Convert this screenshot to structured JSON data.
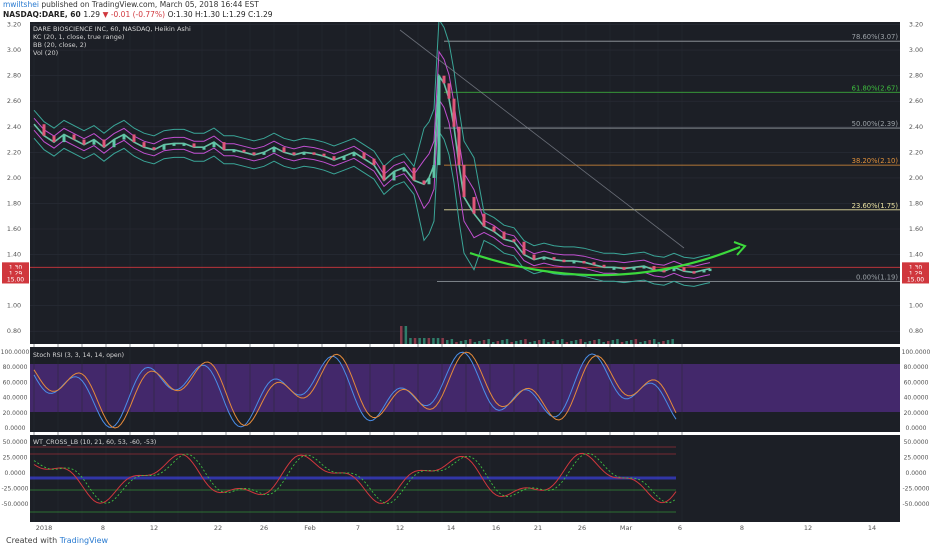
{
  "header": {
    "author": "mwiltshei",
    "published_text": "published on TradingView.com, March 05, 2018 16:44 EST",
    "symbol": "NASDAQ:DARE, 60",
    "last": "1.29",
    "change": "▼ -0.01 (-0.77%)",
    "ohlc": "O:1.30 H:1.30 L:1.29 C:1.29"
  },
  "footer": {
    "created_with": "Created with",
    "brand": "TradingView"
  },
  "legend": {
    "title": "DARE BIOSCIENCE INC, 60, NASDAQ, Heikin Ashi",
    "lines": [
      "KC (20, 1, close, true range)",
      "BB (20, close, 2)",
      "Vol (20)"
    ]
  },
  "price_axis": {
    "ticks": [
      "3.20",
      "3.00",
      "2.80",
      "2.60",
      "2.40",
      "2.20",
      "2.00",
      "1.80",
      "1.60",
      "1.40",
      "1.20",
      "1.00",
      "0.80"
    ],
    "tags": [
      {
        "text": "1.30",
        "color": "#d0373d"
      },
      {
        "text": "1.29",
        "color": "#d0373d"
      },
      {
        "text": "15.00",
        "color": "#d0373d"
      }
    ]
  },
  "x_axis": {
    "labels": [
      "2018",
      "8",
      "12",
      "22",
      "26",
      "Feb",
      "7",
      "12",
      "14",
      "16",
      "21",
      "26",
      "Mar",
      "6",
      "8",
      "12",
      "14"
    ]
  },
  "fib_levels": [
    {
      "label": "78.60%(3.07)",
      "price": 3.07,
      "color": "#9aa0a6"
    },
    {
      "label": "61.80%(2.67)",
      "price": 2.67,
      "color": "#3fbf3f"
    },
    {
      "label": "50.00%(2.39)",
      "price": 2.39,
      "color": "#9aa0a6"
    },
    {
      "label": "38.20%(2.10)",
      "price": 2.1,
      "color": "#e0903a"
    },
    {
      "label": "23.60%(1.75)",
      "price": 1.75,
      "color": "#e8e0a0"
    },
    {
      "label": "0.00%(1.19)",
      "price": 1.19,
      "color": "#9aa0a6"
    }
  ],
  "stoch": {
    "title": "Stoch RSI (3, 3, 14, 14, open)",
    "ticks": [
      "100.0000",
      "80.0000",
      "60.0000",
      "40.0000",
      "20.0000",
      "0.0000"
    ]
  },
  "wt": {
    "title": "WT_CROSS_LB (10, 21, 60, 53, -60, -53)",
    "ticks": [
      "50.0000",
      "25.0000",
      "0.0000",
      "-25.0000",
      "-50.0000"
    ]
  },
  "chart_data": {
    "type": "line",
    "title": "DARE BIOSCIENCE INC, 60, NASDAQ, Heikin Ashi",
    "symbol": "NASDAQ:DARE",
    "interval": "60",
    "ohlc": {
      "open": 1.3,
      "high": 1.3,
      "low": 1.29,
      "close": 1.29
    },
    "ylim": [
      0.7,
      3.22
    ],
    "series": [
      {
        "name": "price",
        "x": [
          0,
          10,
          20,
          30,
          40,
          50,
          60,
          70,
          80,
          90,
          100,
          110,
          120,
          130,
          140,
          150,
          160,
          170,
          180,
          190,
          200,
          210,
          220,
          230,
          240,
          250,
          260,
          270,
          280,
          290,
          300,
          310,
          320,
          330,
          340,
          350,
          360,
          370,
          380,
          390,
          395,
          400,
          405,
          410,
          415,
          420,
          425,
          430,
          440,
          450,
          460,
          470,
          480,
          490,
          500,
          510,
          520,
          530,
          540,
          550,
          560,
          570,
          580,
          590,
          600,
          610,
          620,
          630,
          640,
          650,
          660,
          670,
          676
        ],
        "values": [
          2.42,
          2.33,
          2.28,
          2.34,
          2.3,
          2.26,
          2.3,
          2.24,
          2.3,
          2.34,
          2.28,
          2.24,
          2.22,
          2.26,
          2.27,
          2.27,
          2.24,
          2.24,
          2.28,
          2.22,
          2.22,
          2.2,
          2.18,
          2.2,
          2.24,
          2.2,
          2.18,
          2.2,
          2.19,
          2.17,
          2.14,
          2.17,
          2.2,
          2.15,
          2.1,
          1.98,
          2.05,
          2.08,
          1.98,
          1.95,
          2.0,
          2.1,
          2.8,
          2.74,
          2.62,
          2.4,
          2.1,
          1.85,
          1.72,
          1.62,
          1.58,
          1.52,
          1.5,
          1.4,
          1.36,
          1.38,
          1.36,
          1.35,
          1.35,
          1.34,
          1.32,
          1.3,
          1.3,
          1.29,
          1.3,
          1.31,
          1.28,
          1.27,
          1.3,
          1.27,
          1.26,
          1.28,
          1.29
        ]
      }
    ],
    "horizontal_lines": [
      {
        "price": 1.3,
        "color": "#d0373d"
      }
    ],
    "annotation": "green rounding-bottom curve with arrow"
  }
}
